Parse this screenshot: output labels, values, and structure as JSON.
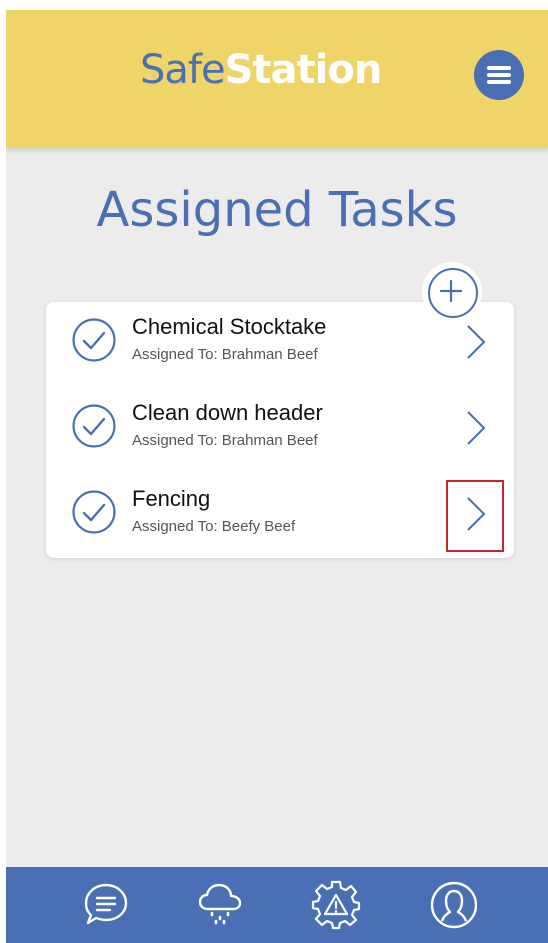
{
  "app": {
    "logo_part1": "Safe",
    "logo_part2": "Station",
    "brand_color": "#4a6fb4",
    "header_color": "#efd567"
  },
  "page": {
    "title": "Assigned Tasks"
  },
  "tasks": [
    {
      "name": "Chemical Stocktake",
      "assigned": "Assigned To: Brahman Beef"
    },
    {
      "name": "Clean down header",
      "assigned": "Assigned To: Brahman Beef"
    },
    {
      "name": "Fencing",
      "assigned": "Assigned To: Beefy Beef"
    }
  ],
  "bottom_nav": [
    {
      "icon": "chat-icon"
    },
    {
      "icon": "weather-icon"
    },
    {
      "icon": "hazard-settings-icon"
    },
    {
      "icon": "profile-icon"
    }
  ]
}
